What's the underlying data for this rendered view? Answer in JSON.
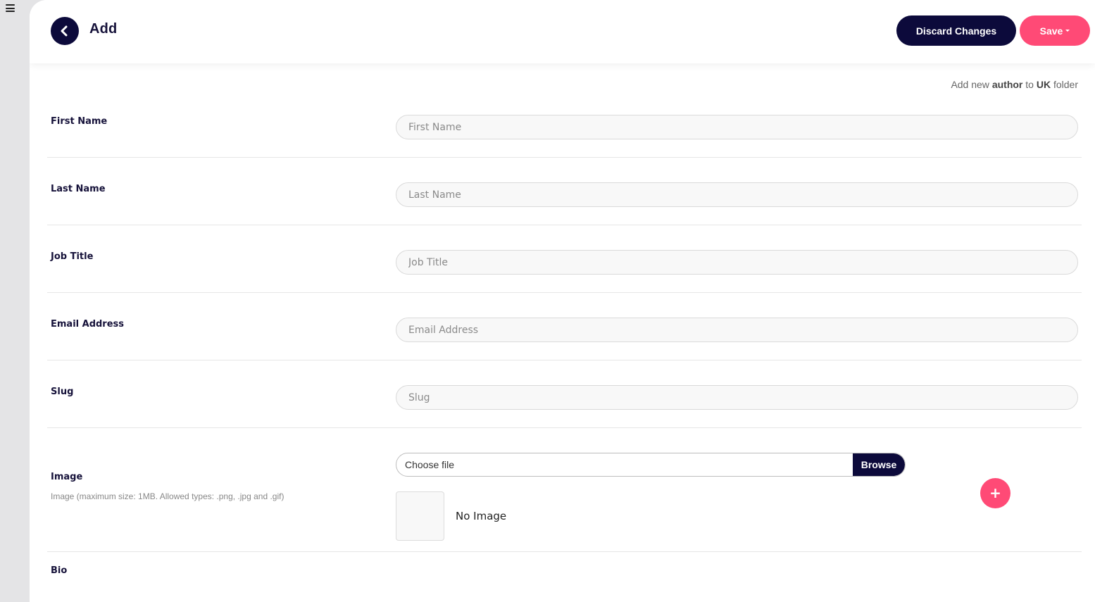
{
  "header": {
    "title": "Add",
    "discard_label": "Discard Changes",
    "save_label": "Save"
  },
  "context": {
    "prefix": "Add new",
    "entity": "author",
    "middle": "to",
    "folder": "UK",
    "suffix": "folder"
  },
  "fields": [
    {
      "label": "First Name",
      "placeholder": "First Name",
      "value": ""
    },
    {
      "label": "Last Name",
      "placeholder": "Last Name",
      "value": ""
    },
    {
      "label": "Job Title",
      "placeholder": "Job Title",
      "value": ""
    },
    {
      "label": "Email Address",
      "placeholder": "Email Address",
      "value": ""
    },
    {
      "label": "Slug",
      "placeholder": "Slug",
      "value": ""
    }
  ],
  "image": {
    "label": "Image",
    "hint": "Image (maximum size: 1MB. Allowed types: .png, .jpg and .gif)",
    "file_label": "Choose file",
    "browse_label": "Browse",
    "empty_text": "No Image",
    "add_label": "+"
  },
  "bio": {
    "label": "Bio"
  },
  "colors": {
    "primary_dark": "#0c0a3b",
    "accent_pink": "#ff4a76"
  },
  "icons": {
    "menu": "hamburger-menu-icon",
    "back": "chevron-left-icon",
    "save_caret": "caret-down-icon"
  }
}
